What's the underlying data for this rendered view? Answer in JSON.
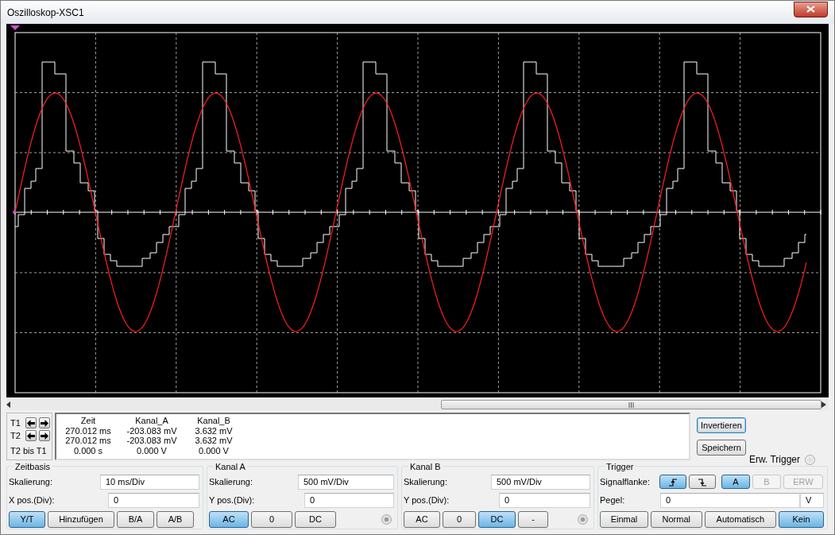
{
  "window": {
    "title": "Oszilloskop-XSC1"
  },
  "cursors": [
    {
      "label": "T1"
    },
    {
      "label": "T2"
    }
  ],
  "cursor_span_label": "T2 bis T1",
  "readout": {
    "columns": [
      "Zeit",
      "Kanal_A",
      "Kanal_B"
    ],
    "rows": [
      [
        "270.012 ms",
        "-203.083 mV",
        "3.632 mV"
      ],
      [
        "270.012 ms",
        "-203.083 mV",
        "3.632 mV"
      ],
      [
        "0.000 s",
        "0.000 V",
        "0.000 V"
      ]
    ]
  },
  "actions": [
    {
      "label": "Invertieren",
      "focused": true
    },
    {
      "label": "Speichern",
      "focused": false
    }
  ],
  "ext_trigger": {
    "label": "Erw. Trigger",
    "checked": false
  },
  "groups": [
    {
      "title": "Zeitbasis",
      "fields": [
        {
          "label": "Skalierung:",
          "value": "10 ms/Div"
        },
        {
          "label": "X pos.(Div):",
          "value": "0"
        }
      ],
      "buttons": [
        {
          "label": "Y/T",
          "selected": true
        },
        {
          "label": "Hinzufügen",
          "selected": false
        },
        {
          "label": "B/A",
          "selected": false
        },
        {
          "label": "A/B",
          "selected": false
        }
      ]
    },
    {
      "title": "Kanal A",
      "fields": [
        {
          "label": "Skalierung:",
          "value": "500 mV/Div"
        },
        {
          "label": "Y pos.(Div):",
          "value": "0"
        }
      ],
      "buttons": [
        {
          "label": "AC",
          "selected": true
        },
        {
          "label": "0",
          "selected": false
        },
        {
          "label": "DC",
          "selected": false
        }
      ],
      "radio_checked": true
    },
    {
      "title": "Kanal B",
      "fields": [
        {
          "label": "Skalierung:",
          "value": "500 mV/Div"
        },
        {
          "label": "Y pos.(Div):",
          "value": "0"
        }
      ],
      "buttons": [
        {
          "label": "AC",
          "selected": false
        },
        {
          "label": "0",
          "selected": false
        },
        {
          "label": "DC",
          "selected": true
        },
        {
          "label": "-",
          "selected": false
        }
      ],
      "radio_checked": true
    }
  ],
  "trigger": {
    "title": "Trigger",
    "edge_label": "Signalflanke:",
    "edges": [
      {
        "kind": "rising",
        "selected": true
      },
      {
        "kind": "falling",
        "selected": false
      }
    ],
    "sources": [
      {
        "label": "A",
        "selected": true,
        "disabled": false
      },
      {
        "label": "B",
        "selected": false,
        "disabled": true
      },
      {
        "label": "ERW",
        "selected": false,
        "disabled": true
      }
    ],
    "level_label": "Pegel:",
    "level_value": "0",
    "level_unit": "V",
    "modes": [
      {
        "label": "Einmal",
        "selected": false
      },
      {
        "label": "Normal",
        "selected": false
      },
      {
        "label": "Automatisch",
        "selected": false
      },
      {
        "label": "Kein",
        "selected": true
      }
    ]
  }
}
